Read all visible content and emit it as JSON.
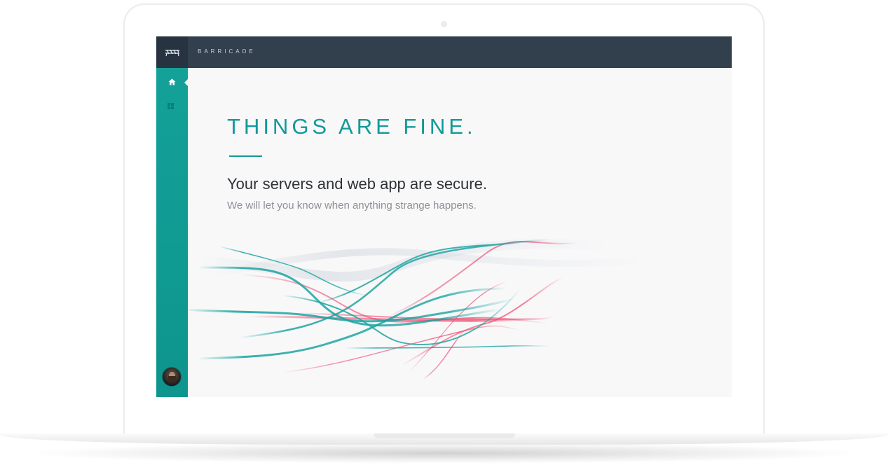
{
  "app": {
    "brand": "BARRICADE"
  },
  "nav": {
    "items": [
      {
        "icon": "home-icon",
        "active": true
      },
      {
        "icon": "grid-icon",
        "active": false
      }
    ],
    "user_avatar": "avatar"
  },
  "main": {
    "headline": "THINGS ARE FINE.",
    "status_title": "Your servers and web app are secure.",
    "status_subtitle": "We will let you know when anything strange happens."
  },
  "colors": {
    "accent": "#13999a",
    "sidebar": "#0f9a92",
    "topbar": "#323f4c",
    "alert_stream": "#ee4a6f",
    "normal_stream": "#19a3a0"
  }
}
